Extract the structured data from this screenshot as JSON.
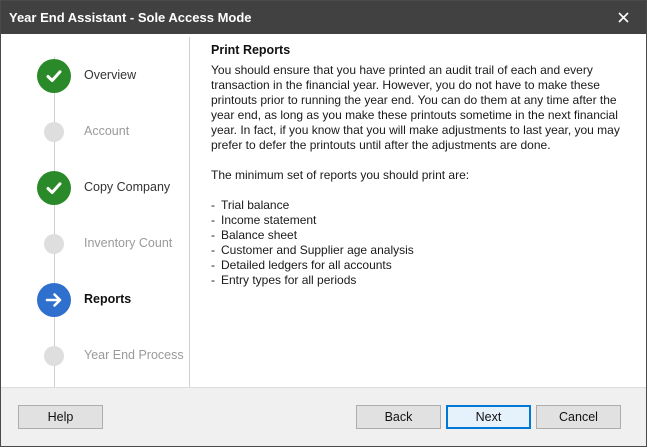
{
  "window": {
    "title": "Year End Assistant - Sole Access Mode",
    "close_icon": "close-icon"
  },
  "steps": [
    {
      "label": "Overview",
      "status": "done",
      "icon": "checkmark-icon"
    },
    {
      "label": "Account",
      "status": "pending",
      "icon": "dot-icon"
    },
    {
      "label": "Copy Company",
      "status": "done",
      "icon": "checkmark-icon"
    },
    {
      "label": "Inventory Count",
      "status": "pending",
      "icon": "dot-icon"
    },
    {
      "label": "Reports",
      "status": "current",
      "icon": "arrow-right-icon"
    },
    {
      "label": "Year End Process",
      "status": "pending",
      "icon": "dot-icon"
    }
  ],
  "main": {
    "heading": "Print Reports",
    "lines_1": [
      "You should ensure that you have printed an audit trail of each and every",
      "transaction in the financial year. However, you do not have to make these",
      "printouts prior to running the year end. You can do them at any time after the",
      "year end, as long as you make these printouts sometime in the next financial",
      "year. In fact, if you know that you will make adjustments to last year, you may",
      "prefer to defer the printouts until after the adjustments are done."
    ],
    "lines_2": [
      "The minimum set of reports you should print are:"
    ],
    "bullet": "-",
    "reports": [
      "Trial balance",
      "Income statement",
      "Balance sheet",
      "Customer and Supplier age analysis",
      "Detailed ledgers for all accounts",
      "Entry types for all periods"
    ]
  },
  "footer": {
    "help_label": "Help",
    "back_label": "Back",
    "next_label": "Next",
    "cancel_label": "Cancel"
  },
  "colors": {
    "titlebar": "#414141",
    "step_done": "#2a8a2a",
    "step_current": "#2f6fcd",
    "step_pending": "#dedede",
    "focus_border": "#0078d7"
  }
}
